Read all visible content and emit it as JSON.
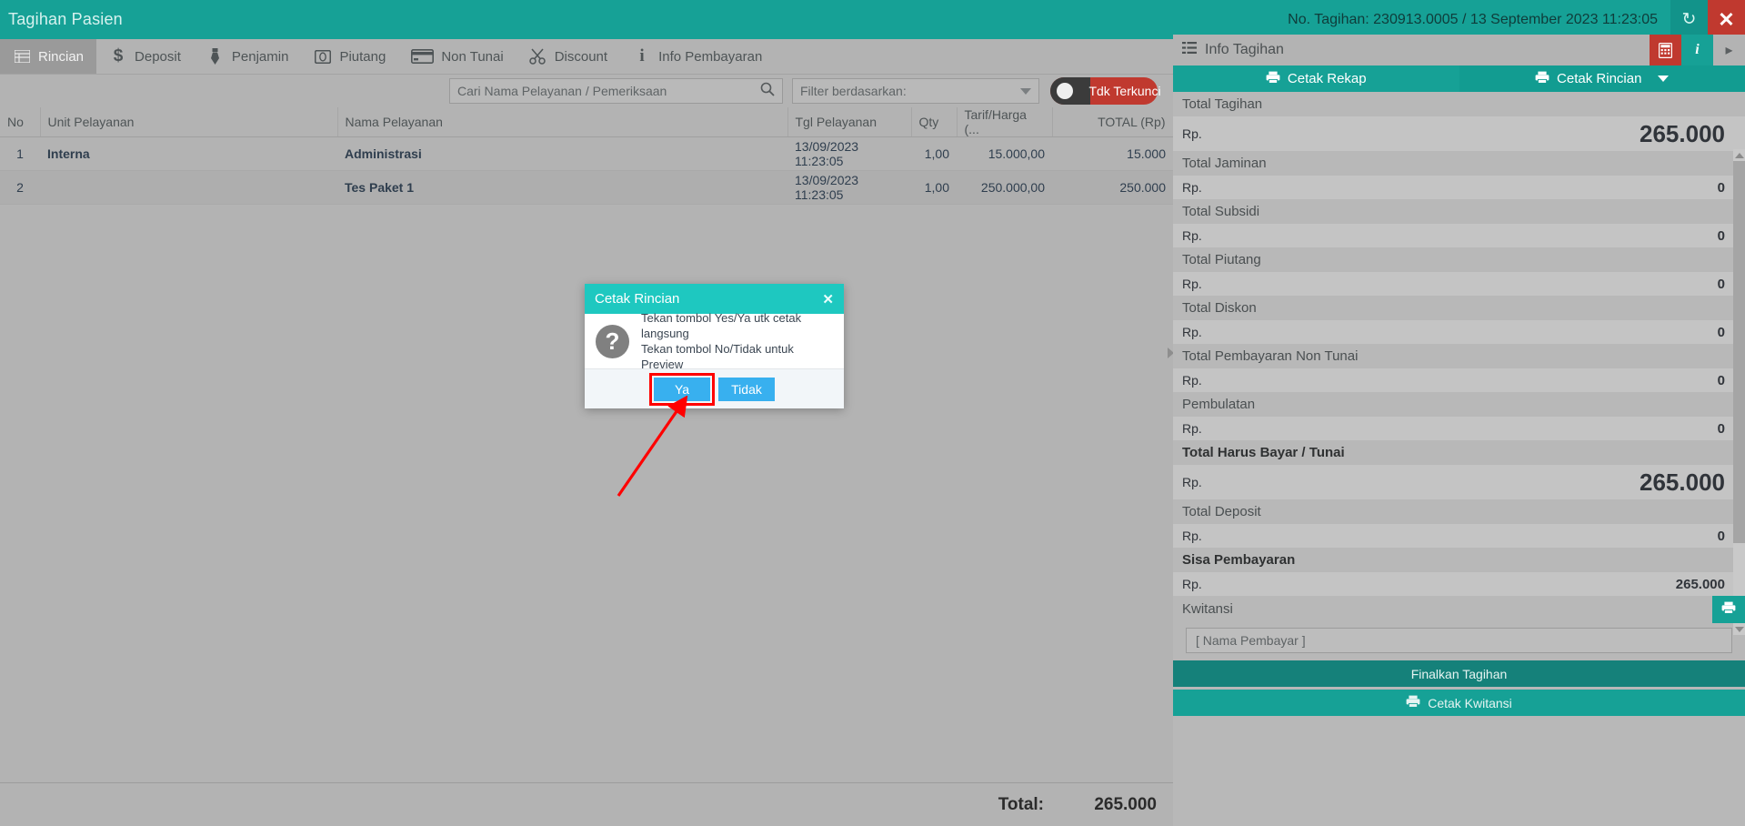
{
  "titlebar": {
    "title": "Tagihan Pasien",
    "invoice_info": "No. Tagihan: 230913.0005 / 13 September 2023 11:23:05",
    "refresh_icon": "refresh-icon",
    "close_icon": "close-icon"
  },
  "tabs": [
    {
      "label": "Rincian",
      "icon": "grid-list-icon",
      "active": true
    },
    {
      "label": "Deposit",
      "icon": "dollar-icon",
      "active": false
    },
    {
      "label": "Penjamin",
      "icon": "tie-icon",
      "active": false
    },
    {
      "label": "Piutang",
      "icon": "coin-icon",
      "active": false
    },
    {
      "label": "Non Tunai",
      "icon": "credit-card-icon",
      "active": false
    },
    {
      "label": "Discount",
      "icon": "scissors-icon",
      "active": false
    },
    {
      "label": "Info Pembayaran",
      "icon": "info-icon",
      "active": false
    }
  ],
  "toolbar": {
    "search_placeholder": "Cari Nama Pelayanan / Pemeriksaan",
    "search_value": "",
    "search_icon": "search-icon",
    "filter_label": "Filter berdasarkan:",
    "filter_value": "",
    "lock_toggle_label": "Tdk Terkunci",
    "lock_toggle_state": "off"
  },
  "table": {
    "columns": [
      "No",
      "Unit Pelayanan",
      "Nama Pelayanan",
      "Tgl Pelayanan",
      "Qty",
      "Tarif/Harga (...",
      "TOTAL (Rp)"
    ],
    "rows": [
      {
        "no": "1",
        "unit": "Interna",
        "nama": "Administrasi",
        "tgl": "13/09/2023 11:23:05",
        "qty": "1,00",
        "tarif": "15.000,00",
        "total": "15.000"
      },
      {
        "no": "2",
        "unit": "",
        "nama": "Tes Paket 1",
        "tgl": "13/09/2023 11:23:05",
        "qty": "1,00",
        "tarif": "250.000,00",
        "total": "250.000"
      }
    ],
    "footer_label": "Total:",
    "footer_value": "265.000"
  },
  "rightpanel": {
    "header_title": "Info Tagihan",
    "header_icon": "list-icon",
    "calc_icon": "calculator-icon",
    "info_icon": "info-icon",
    "expand_icon": "chevron-right-icon",
    "print_tabs": [
      {
        "label": "Cetak Rekap",
        "icon": "printer-icon"
      },
      {
        "label": "Cetak Rincian",
        "icon": "printer-icon"
      }
    ],
    "currency_prefix": "Rp.",
    "items": [
      {
        "label": "Total Tagihan",
        "value": "265.000",
        "emphasis": "large",
        "bold_label": false
      },
      {
        "label": "Total Jaminan",
        "value": "0",
        "emphasis": "normal",
        "bold_label": false
      },
      {
        "label": "Total Subsidi",
        "value": "0",
        "emphasis": "normal",
        "bold_label": false
      },
      {
        "label": "Total Piutang",
        "value": "0",
        "emphasis": "normal",
        "bold_label": false
      },
      {
        "label": "Total Diskon",
        "value": "0",
        "emphasis": "normal",
        "bold_label": false
      },
      {
        "label": "Total Pembayaran Non Tunai",
        "value": "0",
        "emphasis": "normal",
        "bold_label": false
      },
      {
        "label": "Pembulatan",
        "value": "0",
        "emphasis": "normal",
        "bold_label": false
      },
      {
        "label": "Total Harus Bayar / Tunai",
        "value": "265.000",
        "emphasis": "large",
        "bold_label": true
      },
      {
        "label": "Total Deposit",
        "value": "0",
        "emphasis": "normal",
        "bold_label": false
      },
      {
        "label": "Sisa Pembayaran",
        "value": "265.000",
        "emphasis": "normal",
        "bold_label": true
      }
    ],
    "kwitansi_label": "Kwitansi",
    "kwitansi_print_icon": "printer-icon",
    "pembayar_placeholder": "[ Nama Pembayar ]",
    "pembayar_value": "",
    "finalkan_label": "Finalkan Tagihan",
    "cetak_kwitansi_label": "Cetak Kwitansi",
    "cetak_kwitansi_icon": "printer-icon"
  },
  "modal": {
    "title": "Cetak Rincian",
    "close_icon": "close-icon",
    "icon": "question-mark-icon",
    "icon_glyph": "?",
    "message_line1": "Tekan tombol Yes/Ya utk cetak langsung",
    "message_line2": "Tekan tombol No/Tidak untuk Preview",
    "yes_label": "Ya",
    "no_label": "Tidak",
    "highlight_color": "#ff0000"
  },
  "annotation": {
    "type": "arrow",
    "color": "#ff0000",
    "points_to": "Ya"
  }
}
